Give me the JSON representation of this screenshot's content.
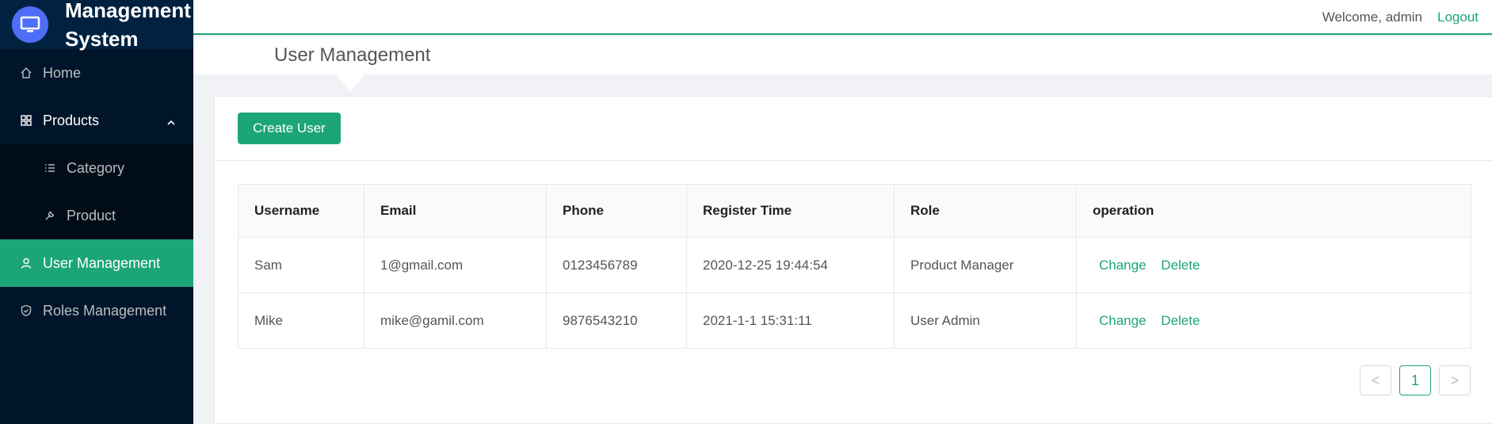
{
  "app": {
    "title": "Management System"
  },
  "sidebar": {
    "items": [
      {
        "label": "Home",
        "icon": "home-icon"
      },
      {
        "label": "Products",
        "icon": "grid-icon"
      },
      {
        "label": "Category",
        "icon": "list-icon"
      },
      {
        "label": "Product",
        "icon": "wrench-icon"
      },
      {
        "label": "User Management",
        "icon": "user-icon"
      },
      {
        "label": "Roles Management",
        "icon": "shield-icon"
      }
    ]
  },
  "header": {
    "welcome": "Welcome, admin",
    "logout": "Logout"
  },
  "page": {
    "title": "User Management"
  },
  "toolbar": {
    "create_label": "Create User"
  },
  "table": {
    "columns": [
      "Username",
      "Email",
      "Phone",
      "Register Time",
      "Role",
      "operation"
    ],
    "rows": [
      {
        "username": "Sam",
        "email": "1@gmail.com",
        "phone": "0123456789",
        "register_time": "2020-12-25 19:44:54",
        "role": "Product Manager"
      },
      {
        "username": "Mike",
        "email": "mike@gamil.com",
        "phone": "9876543210",
        "register_time": "2021-1-1 15:31:11",
        "role": "User Admin"
      }
    ],
    "actions": {
      "change": "Change",
      "delete": "Delete"
    }
  },
  "pagination": {
    "prev": "<",
    "current": "1",
    "next": ">"
  },
  "colors": {
    "accent": "#1da57a",
    "sidebar_bg": "#001529",
    "logo_circle": "#4f6ef7"
  }
}
